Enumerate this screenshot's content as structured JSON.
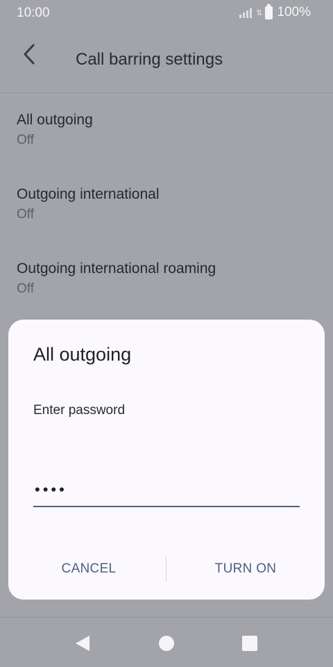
{
  "status": {
    "time": "10:00",
    "battery": "100%"
  },
  "header": {
    "title": "Call barring settings"
  },
  "list": [
    {
      "title": "All outgoing",
      "subtitle": "Off"
    },
    {
      "title": "Outgoing international",
      "subtitle": "Off"
    },
    {
      "title": "Outgoing international roaming",
      "subtitle": "Off"
    }
  ],
  "dialog": {
    "title": "All outgoing",
    "label": "Enter password",
    "password_mask": "••••",
    "cancel_label": "CANCEL",
    "confirm_label": "TURN ON"
  },
  "icons": {
    "back": "arrow-back-icon",
    "nav_back": "nav-back-triangle-icon",
    "nav_home": "nav-home-circle-icon",
    "nav_recent": "nav-recents-square-icon"
  },
  "colors": {
    "accent": "#4c5f86",
    "scrim": "#a3a4aa",
    "dialog": "#fbf9fd"
  }
}
